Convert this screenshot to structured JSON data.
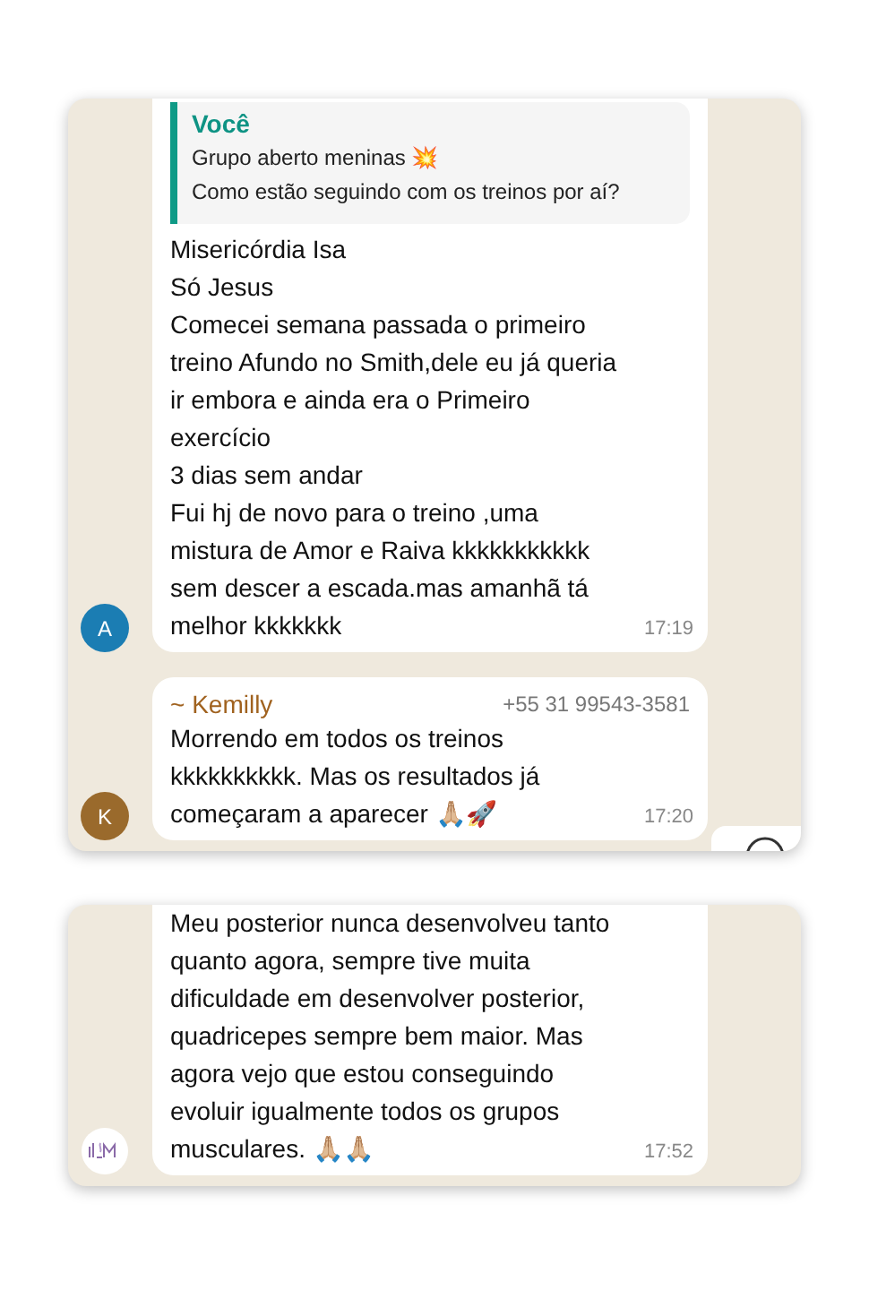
{
  "cards": [
    {
      "messages": [
        {
          "kind": "reply",
          "quote": {
            "author": "Você",
            "text": "Grupo aberto meninas 💥\nComo estão seguindo com os treinos por aí?"
          },
          "text": "Misericórdia Isa\nSó Jesus\nComecei semana passada o primeiro\ntreino Afundo no Smith,dele eu já queria\nir embora e ainda era o Primeiro\nexercício\n3 dias sem andar\nFui hj de novo para o treino ,uma\nmistura de Amor e Raiva kkkkkkkkkkk\nsem descer a escada.mas amanhã tá\nmelhor kkkkkkk",
          "time": "17:19",
          "avatar": {
            "kind": "letter",
            "letter": "A",
            "color": "#1b7db3"
          }
        },
        {
          "kind": "named",
          "sender": "~ Kemilly",
          "phone": "+55 31 99543-3581",
          "text": "Morrendo em todos os treinos\nkkkkkkkkkk. Mas os resultados já\ncomeçaram a aparecer 🙏🏼🚀",
          "time": "17:20",
          "avatar": {
            "kind": "letter",
            "letter": "K",
            "color": "#9a6a2c"
          }
        }
      ],
      "floating_button": true
    },
    {
      "messages": [
        {
          "kind": "plain",
          "text": "Meu posterior nunca desenvolveu tanto\nquanto agora, sempre tive muita\ndificuldade em desenvolver posterior,\nquadricepes sempre bem maior. Mas\nagora vejo que estou conseguindo\nevoluir igualmente todos os grupos\nmusculares. 🙏🏼🙏🏼",
          "time": "17:52",
          "avatar": {
            "kind": "logo"
          }
        }
      ],
      "floating_button": false
    }
  ]
}
